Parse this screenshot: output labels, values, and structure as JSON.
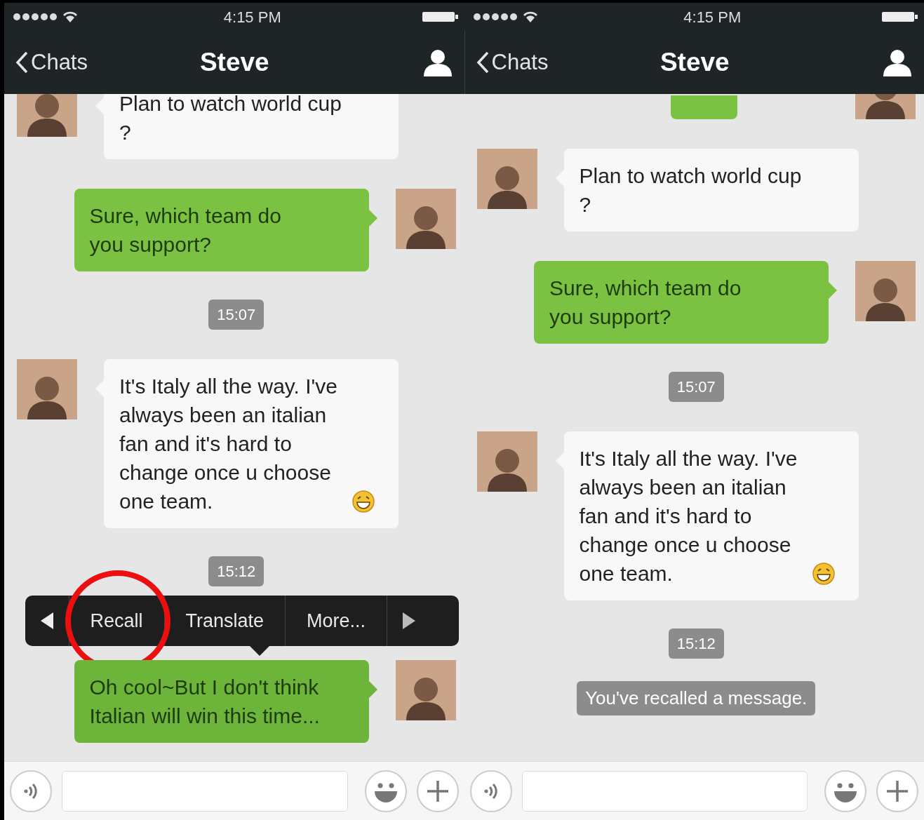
{
  "screens": [
    {
      "status_bar": {
        "time": "4:15 PM"
      },
      "nav": {
        "back": "Chats",
        "title": "Steve"
      },
      "messages": [
        {
          "kind": "incoming",
          "text": "Plan to watch world cup ?",
          "emoji": false,
          "selected": false
        },
        {
          "kind": "outgoing",
          "text": "Sure, which team do you support?",
          "emoji": false,
          "selected": false
        },
        {
          "kind": "timestamp",
          "text": "15:07"
        },
        {
          "kind": "incoming",
          "text": "It's Italy all the way. I've always been an italian fan and it's hard to change once u choose one team.",
          "emoji": true,
          "selected": false
        },
        {
          "kind": "timestamp",
          "text": "15:12"
        },
        {
          "kind": "outgoing",
          "text": "Oh cool~But I don't think Italian will win this time...",
          "emoji": false,
          "selected": true,
          "menu": [
            {
              "label": "Recall",
              "circled": true
            },
            {
              "label": "Translate",
              "circled": false
            },
            {
              "label": "More...",
              "circled": false
            }
          ]
        }
      ]
    },
    {
      "status_bar": {
        "time": "4:15 PM"
      },
      "nav": {
        "back": "Chats",
        "title": "Steve"
      },
      "messages": [
        {
          "kind": "clipped"
        },
        {
          "kind": "incoming",
          "text": "Plan to watch world cup ?",
          "emoji": false,
          "selected": false
        },
        {
          "kind": "outgoing",
          "text": "Sure, which team do you support?",
          "emoji": false,
          "selected": false
        },
        {
          "kind": "timestamp",
          "text": "15:07"
        },
        {
          "kind": "incoming",
          "text": "It's Italy all the way. I've always been an italian fan and it's hard to change once u choose one team.",
          "emoji": true,
          "selected": false
        },
        {
          "kind": "timestamp",
          "text": "15:12"
        },
        {
          "kind": "system",
          "text": "You've recalled a message."
        }
      ]
    }
  ]
}
